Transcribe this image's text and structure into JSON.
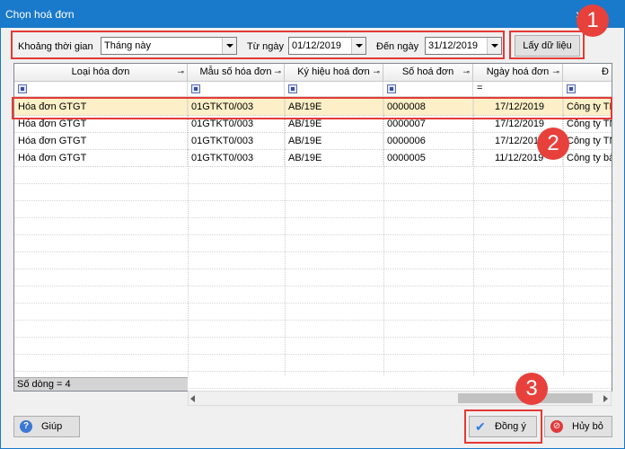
{
  "window": {
    "title": "Chọn hoá đơn",
    "close_glyph": "×"
  },
  "filters": {
    "period_label": "Khoảng thời gian",
    "period_value": "Tháng này",
    "from_label": "Từ ngày",
    "from_value": "01/12/2019",
    "to_label": "Đến ngày",
    "to_value": "31/12/2019",
    "fetch_label": "Lấy dữ liệu"
  },
  "grid": {
    "columns": [
      "Loại hóa đơn",
      "Mẫu số hóa đơn",
      "Ký hiệu hoá đơn",
      "Số hoá đơn",
      "Ngày hoá đơn",
      "Đ"
    ],
    "filter_eq": "=",
    "rows": [
      {
        "type": "Hóa đơn GTGT",
        "template": "01GTKT0/003",
        "symbol": "AB/19E",
        "number": "0000008",
        "date": "17/12/2019",
        "partner": "Công ty TNHH"
      },
      {
        "type": "Hóa đơn GTGT",
        "template": "01GTKT0/003",
        "symbol": "AB/19E",
        "number": "0000007",
        "date": "17/12/2019",
        "partner": "Công ty TNHH"
      },
      {
        "type": "Hóa đơn GTGT",
        "template": "01GTKT0/003",
        "symbol": "AB/19E",
        "number": "0000006",
        "date": "17/12/2019",
        "partner": "Công ty TNHH"
      },
      {
        "type": "Hóa đơn GTGT",
        "template": "01GTKT0/003",
        "symbol": "AB/19E",
        "number": "0000005",
        "date": "11/12/2019",
        "partner": "Công ty bảo"
      }
    ],
    "row_count": "Số dòng = 4"
  },
  "footer": {
    "help_label": "Giúp",
    "ok_label": "Đồng ý",
    "cancel_label": "Hủy bỏ"
  },
  "callouts": [
    "1",
    "2",
    "3"
  ],
  "colors": {
    "title_bar": "#1979ca",
    "selected_row": "#fdf0c8",
    "highlight": "#e53935",
    "badge": "#e8413c"
  }
}
